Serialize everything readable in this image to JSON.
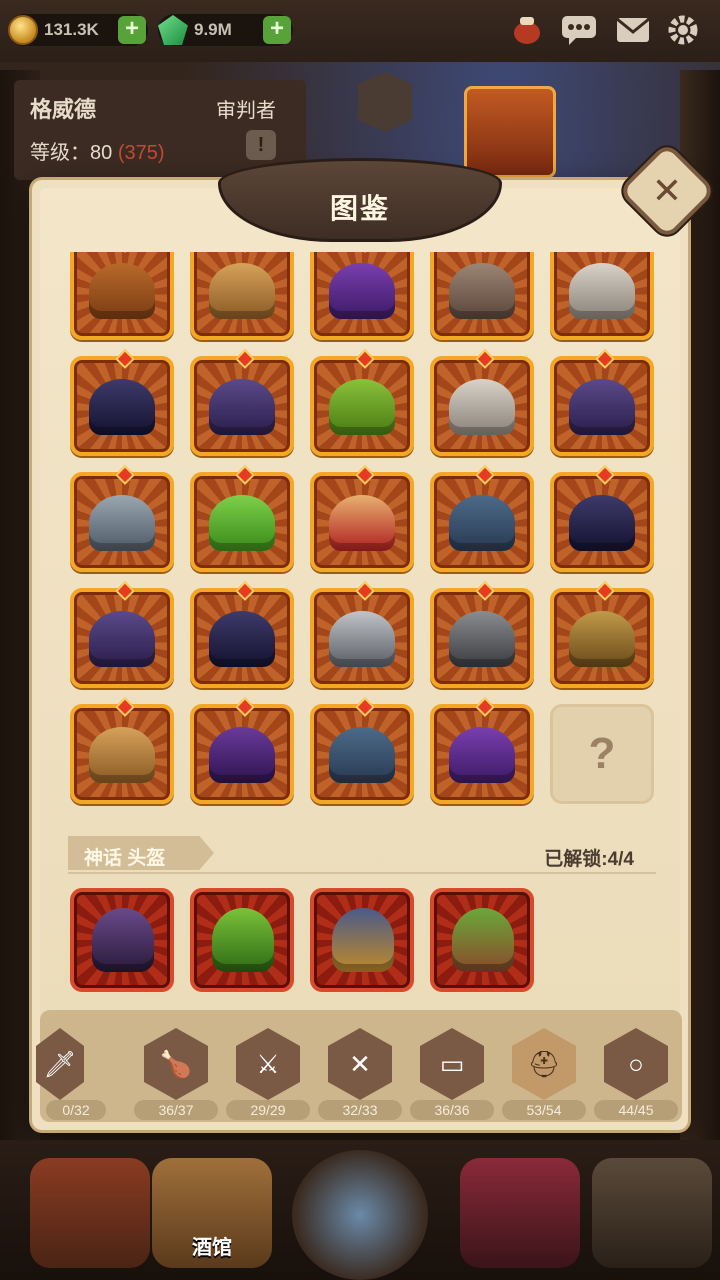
{
  "resources": {
    "gold": "131.3K",
    "gems": "9.9M"
  },
  "hero": {
    "name": "格威德",
    "class": "审判者",
    "level_label": "等级：80",
    "level_extra": "(375)"
  },
  "dialog": {
    "title": "图鉴",
    "close_symbol": "✕"
  },
  "grid_items": [
    "leather-helmet",
    "feather-hat",
    "purple-witch-hat",
    "bone-mask",
    "porcelain-mask",
    "dark-hood",
    "purple-top-hat",
    "green-hood",
    "porcelain-mask",
    "purple-top-hat",
    "iron-helmet",
    "green-leaf-cap",
    "ruby-circlet",
    "fur-trim-helmet",
    "dark-hood",
    "purple-top-hat",
    "dark-hood",
    "knight-helmet",
    "great-helm",
    "bronze-helmet",
    "feather-hat",
    "purple-cowl",
    "fur-trim-helmet",
    "purple-witch-hat",
    "locked"
  ],
  "locked_symbol": "?",
  "section": {
    "label": "神话 头盔",
    "unlock_text": "已解锁:4/4",
    "mythic_items": [
      "skull-hood",
      "green-witch-hat",
      "crowned-helm",
      "slime-drum"
    ]
  },
  "tabs": [
    {
      "icon": "sword-icon",
      "count": "0/32"
    },
    {
      "icon": "drumstick-icon",
      "count": "36/37"
    },
    {
      "icon": "dagger-icon",
      "count": "29/29"
    },
    {
      "icon": "shield-icon",
      "count": "32/33"
    },
    {
      "icon": "book-icon",
      "count": "36/36"
    },
    {
      "icon": "helmet-icon",
      "count": "53/54",
      "active": true
    },
    {
      "icon": "ring-icon",
      "count": "44/45"
    }
  ],
  "bottom_nav": {
    "tavern_label": "酒馆"
  },
  "colors": {
    "frame_gold": "#f5a623",
    "mythic_red": "#d94a2a",
    "parchment": "#efe0c1",
    "level_red": "#c24a35"
  }
}
